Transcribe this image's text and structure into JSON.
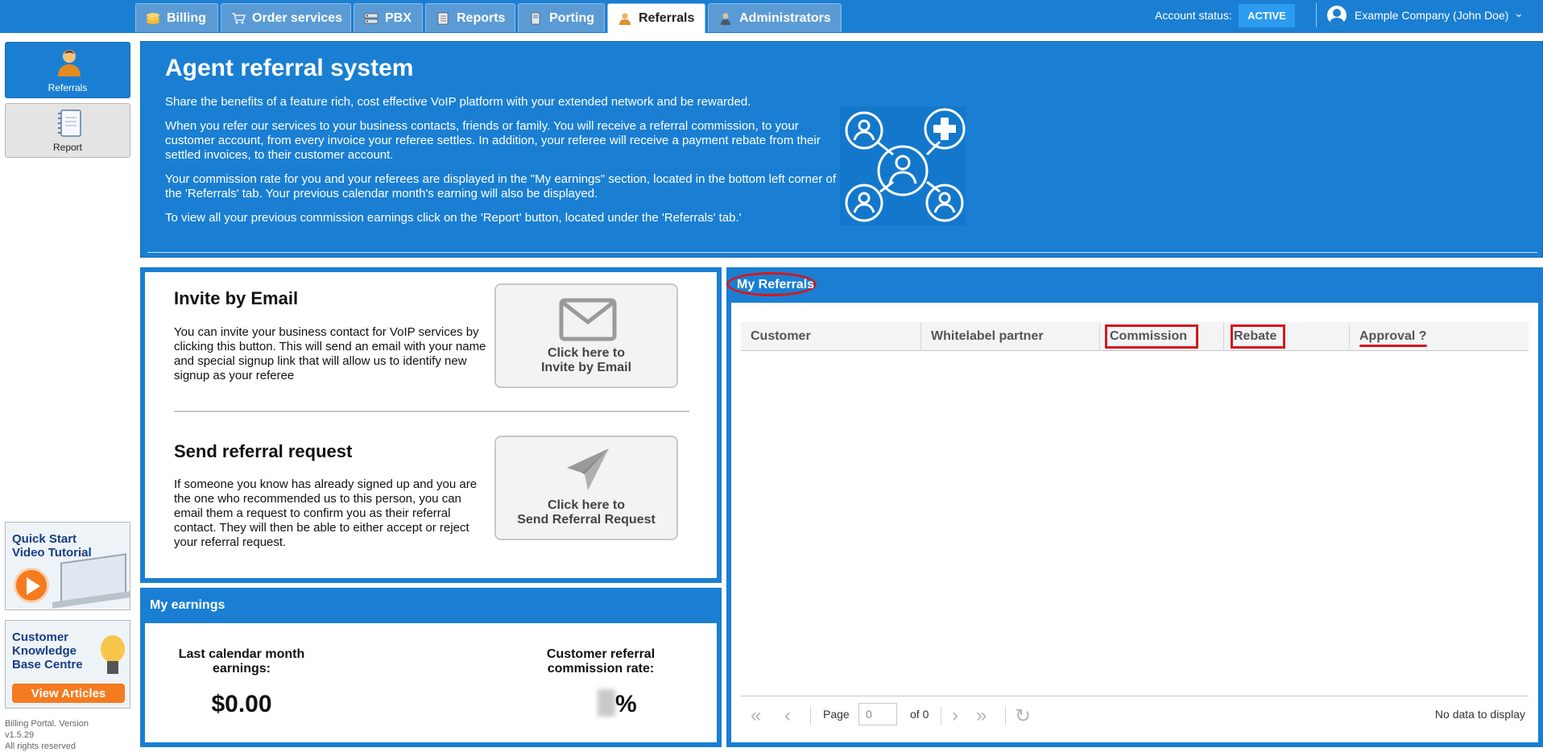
{
  "topbar": {
    "tabs": [
      {
        "label": "Billing",
        "icon": "coins-icon",
        "active": false
      },
      {
        "label": "Order services",
        "icon": "cart-icon",
        "active": false
      },
      {
        "label": "PBX",
        "icon": "server-icon",
        "active": false
      },
      {
        "label": "Reports",
        "icon": "report-book-icon",
        "active": false
      },
      {
        "label": "Porting",
        "icon": "phone-icon",
        "active": false
      },
      {
        "label": "Referrals",
        "icon": "person-icon",
        "active": true
      },
      {
        "label": "Administrators",
        "icon": "admin-icon",
        "active": false
      }
    ],
    "account_status_label": "Account status:",
    "account_status_value": "ACTIVE",
    "user_name": "Example Company (John Doe)",
    "accent": "#1a7fd2"
  },
  "sidebar": {
    "items": [
      {
        "label": "Referrals",
        "icon": "person-icon",
        "active": true
      },
      {
        "label": "Report",
        "icon": "notebook-icon",
        "active": false
      }
    ],
    "promo_video": {
      "line1": "Quick Start",
      "line2": "Video Tutorial"
    },
    "promo_kb": {
      "line1": "Customer",
      "line2": "Knowledge",
      "line3": "Base Centre",
      "button": "View Articles"
    },
    "footer": {
      "line1": "Billing Portal. Version",
      "line2": "v1.5.29",
      "line3": "All rights reserved"
    }
  },
  "hero": {
    "title": "Agent referral system",
    "p1": "Share the benefits of a feature rich, cost effective VoIP platform with your extended network and be rewarded.",
    "p2": "When you refer our services to your business contacts, friends or family. You will receive a referral commission, to your customer account, from every invoice your referee settles. In addition, your referee will receive a payment rebate from their settled invoices, to their customer account.",
    "p3": "Your commission rate for you and your referees are displayed in the \"My earnings\" section, located in the bottom left corner of the 'Referrals' tab. Your previous calendar month's earning will also be displayed.",
    "p4": "To view all your previous commission earnings click on the 'Report' button, located under the 'Referrals' tab.'"
  },
  "invite": {
    "title": "Invite by Email",
    "text": "You can invite your business contact for VoIP services by clicking this button. This will send an email with your name and special signup link that will allow us to identify new signup as your referee",
    "button_line1": "Click here to",
    "button_line2": "Invite by Email"
  },
  "request": {
    "title": "Send referral request",
    "text": "If someone you know has already signed up and you are the one who recommended us to this person, you can email them a request to confirm you as their referral contact. They will then be able to either accept or reject your referral request.",
    "button_line1": "Click here to",
    "button_line2": "Send Referral Request"
  },
  "earnings": {
    "title": "My earnings",
    "last_month_label": "Last calendar month earnings:",
    "last_month_value": "$0.00",
    "rate_label": "Customer referral commission rate:",
    "rate_suffix": "%"
  },
  "referrals": {
    "title": "My Referrals",
    "columns": [
      "Customer",
      "Whitelabel partner",
      "Commission",
      "Rebate",
      "Approval ?"
    ],
    "pager": {
      "page_label": "Page",
      "page_value": "0",
      "of_label": "of 0",
      "empty": "No data to display"
    }
  }
}
